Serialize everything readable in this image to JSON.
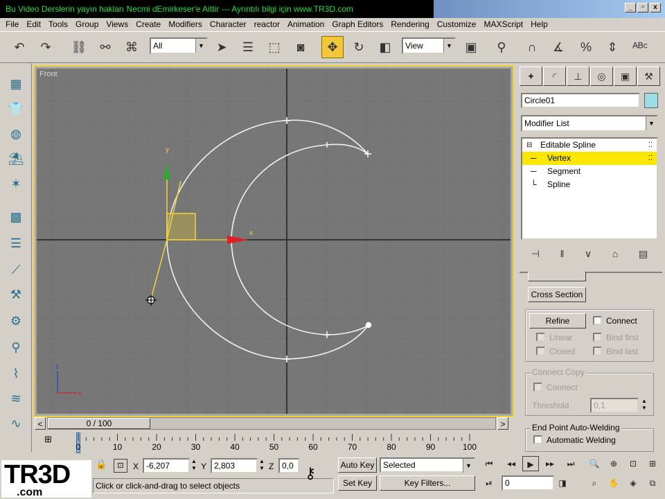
{
  "app": {
    "title": "Bu Video Derslerin yayın hakları Necmi dEmirkeser'e Aittir --- Ayrıntılı bilgi için www.TR3D.com",
    "window_buttons": [
      "_",
      "▫",
      "x"
    ]
  },
  "menu": [
    "File",
    "Edit",
    "Tools",
    "Group",
    "Views",
    "Create",
    "Modifiers",
    "Character",
    "reactor",
    "Animation",
    "Graph Editors",
    "Rendering",
    "Customize",
    "MAXScript",
    "Help"
  ],
  "toolbar": {
    "selection_filter": "All",
    "coord_system": "View",
    "icons": [
      "undo-icon",
      "redo-icon",
      "link-icon",
      "unlink-icon",
      "bind-spacewarp-icon",
      "select-arrow-icon",
      "select-by-name-icon",
      "rect-region-icon",
      "window-crossing-icon",
      "move-icon",
      "rotate-icon",
      "scale-icon",
      "pivot-icon",
      "mirror-icon",
      "snap-3d-icon",
      "angle-snap-icon",
      "percent-snap-icon",
      "spinner-snap-icon"
    ]
  },
  "left_toolbar": [
    "box-icon",
    "shirt-icon",
    "sphere-icon",
    "cloth-icon",
    "character-icon",
    "mesh-icon",
    "stack-icon",
    "bone-icon",
    "wrench-icon",
    "gear-icon",
    "pin-icon",
    "spring-icon",
    "wind-icon",
    "wave-icon"
  ],
  "viewport": {
    "label": "Front",
    "axis_x_label": "x",
    "axis_y_label": "y",
    "corner_axis_z": "z",
    "corner_axis_x": "x"
  },
  "command_panel": {
    "tabs": [
      "create-tab",
      "modify-tab",
      "hierarchy-tab",
      "motion-tab",
      "display-tab",
      "utilities-tab"
    ],
    "object_name": "Circle01",
    "object_color": "#9ddde6",
    "modifier_list": "Modifier List",
    "stack": {
      "root": "Editable Spline",
      "items": [
        "Vertex",
        "Segment",
        "Spline"
      ],
      "selected": "Vertex"
    },
    "cross_section_label": "Cross Section",
    "refine_label": "Refine",
    "connect_label": "Connect",
    "linear_label": "Linear",
    "bind_first_label": "Bind first",
    "closed_label": "Closed",
    "bind_last_label": "Bind last",
    "connect_copy_title": "Connect Copy",
    "connect_copy_connect_label": "Connect",
    "threshold_label": "Threshold",
    "threshold_value": "0,1",
    "end_point_title": "End Point Auto-Welding",
    "auto_weld_label": "Automatic Welding"
  },
  "time_slider": {
    "value_text": "0 / 100",
    "left_arrow": "<",
    "right_arrow": ">",
    "current_fraction": 0
  },
  "trackbar": {
    "ticks": [
      "0",
      "10",
      "20",
      "30",
      "40",
      "50",
      "60",
      "70",
      "80",
      "90",
      "100"
    ]
  },
  "status": {
    "logo_main": "TR3D",
    "logo_sub": ".com",
    "x_label": "X",
    "x_value": "-6,207",
    "y_label": "Y",
    "y_value": "2,803",
    "z_label": "Z",
    "z_value": "0,0",
    "prompt": "Click or click-and-drag to select objects",
    "auto_key": "Auto Key",
    "set_key": "Set Key",
    "key_mode": "Selected",
    "key_filters": "Key Filters...",
    "frame_value": "0"
  }
}
